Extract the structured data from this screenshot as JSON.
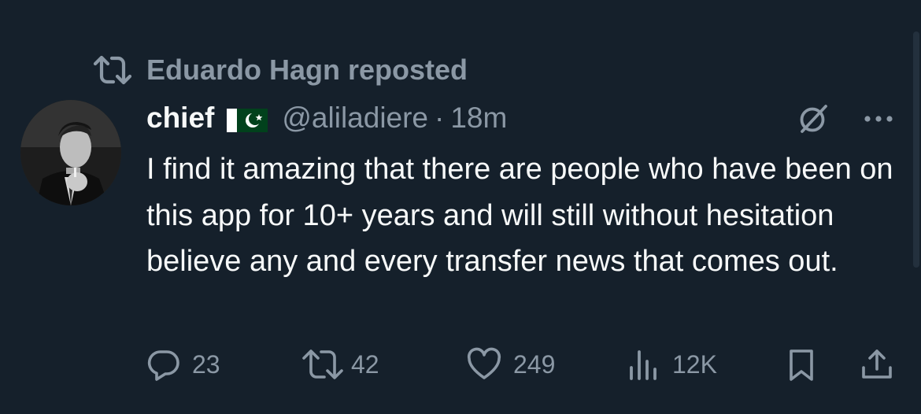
{
  "repost": {
    "text": "Eduardo Hagn reposted",
    "icon": "repost-icon"
  },
  "tweet": {
    "display_name": "chief",
    "flag_icon": "pakistan-flag",
    "handle": "@aliladiere",
    "separator": "·",
    "time": "18m",
    "text": "I find it amazing that there are people who have been on this app for 10+ years and will still without hesitation believe any and every transfer news that comes out."
  },
  "actions": {
    "replies": "23",
    "reposts": "42",
    "likes": "249",
    "views": "12K"
  },
  "colors": {
    "background": "#15202b",
    "primary_text": "#f7f9f9",
    "secondary_text": "#8b98a5",
    "flag_green": "#01411c"
  }
}
